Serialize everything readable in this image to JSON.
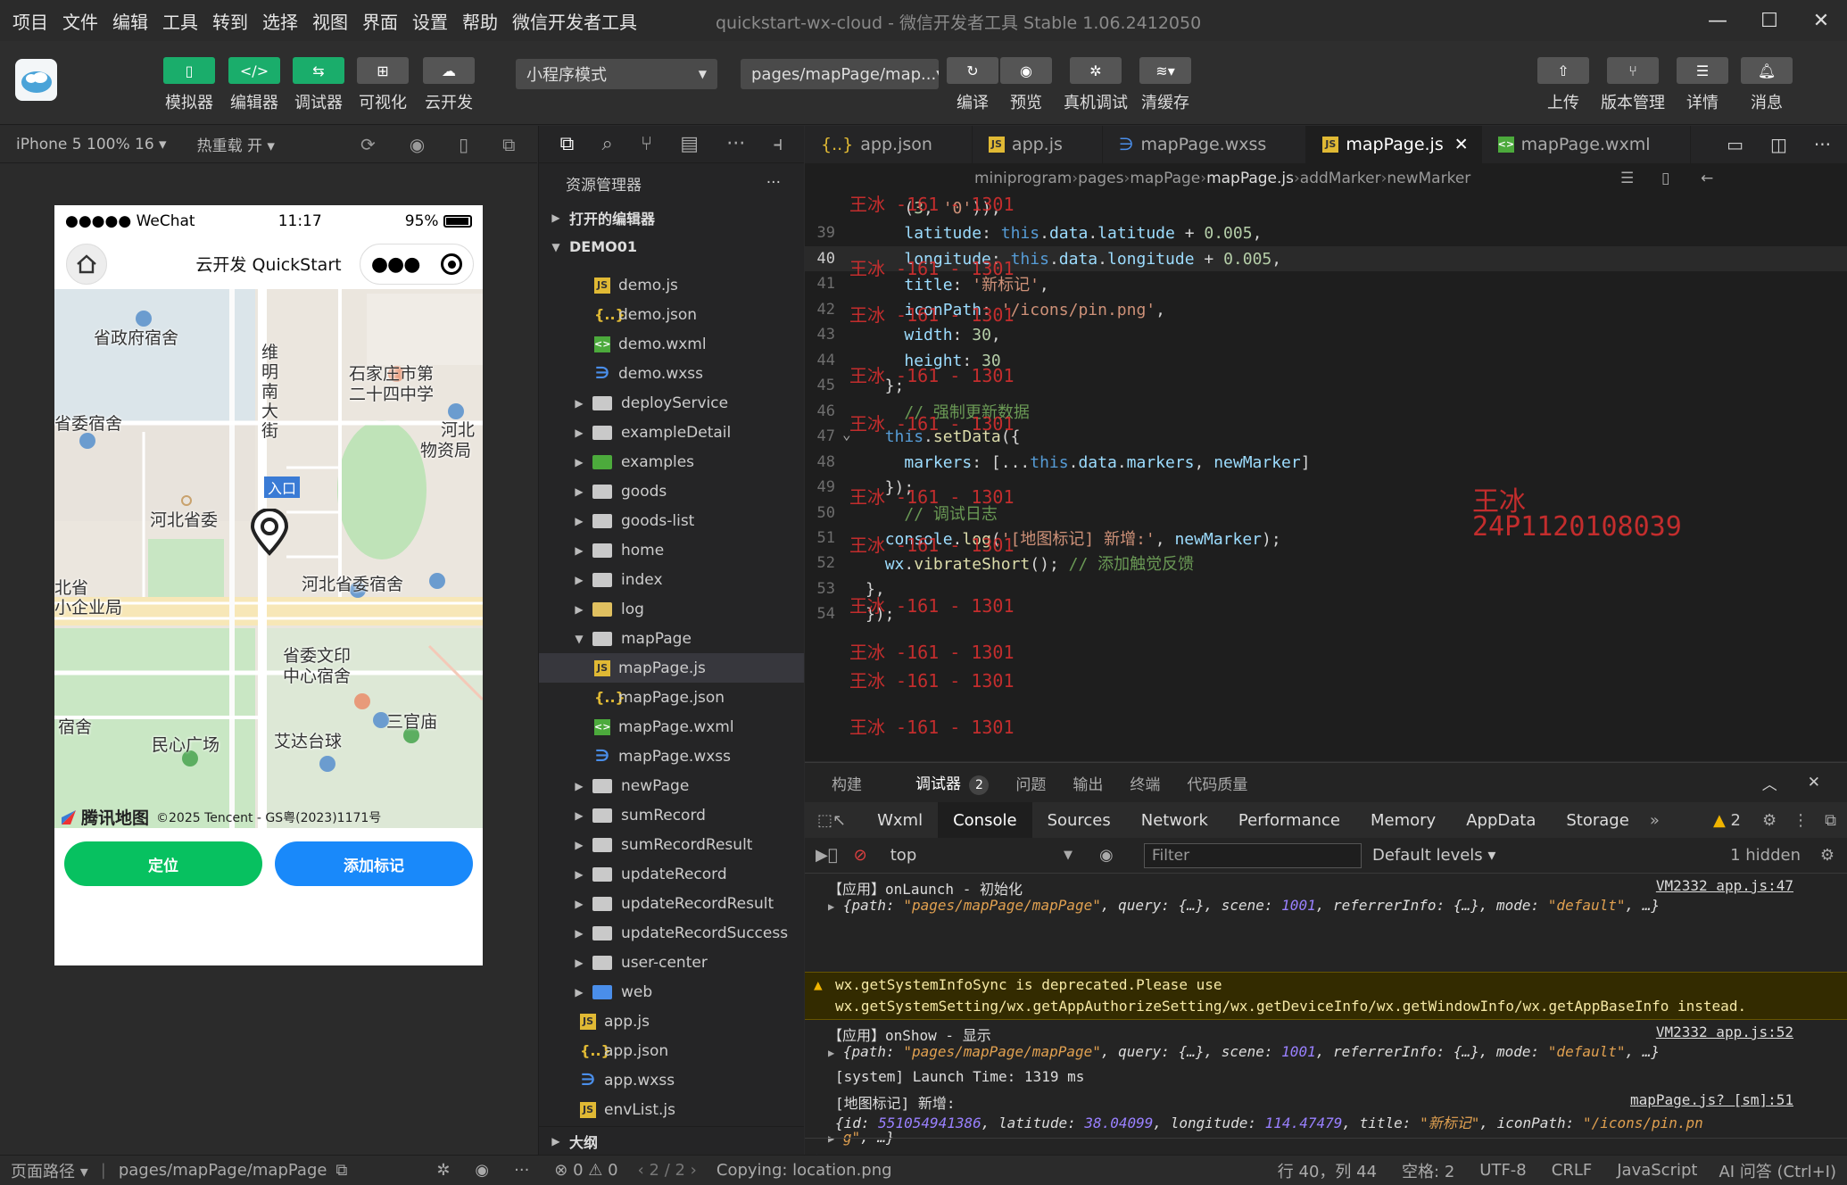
{
  "menu": [
    "项目",
    "文件",
    "编辑",
    "工具",
    "转到",
    "选择",
    "视图",
    "界面",
    "设置",
    "帮助",
    "微信开发者工具"
  ],
  "window_title": "quickstart-wx-cloud - 微信开发者工具 Stable 1.06.2412050",
  "toolbar": {
    "simulator": "模拟器",
    "editor": "编辑器",
    "debugger": "调试器",
    "visual": "可视化",
    "cloud": "云开发",
    "mode_select": "小程序模式",
    "page_select": "pages/mapPage/map...",
    "compile": "编译",
    "preview": "预览",
    "device_debug": "真机调试",
    "clear_cache": "清缓存",
    "upload": "上传",
    "version": "版本管理",
    "details": "详情",
    "messages": "消息"
  },
  "simbar": {
    "device": "iPhone 5 100% 16",
    "hot_reload": "热重载 开"
  },
  "phone": {
    "carrier": "●●●●● WeChat",
    "time": "11:17",
    "battery": "95%",
    "title": "云开发 QuickStart",
    "map_labels": {
      "l1": "省政府宿舍",
      "l2": "石家庄市第",
      "l3": "二十四中学",
      "l4": "省委宿舍",
      "l5": "河北",
      "l6": "物资局",
      "l7": "河北省委",
      "l8": "河北省委宿舍",
      "l9": "北省",
      "l10": "小企业局",
      "l11": "省委文印",
      "l12": "中心宿舍",
      "l13": "三官庙",
      "l14": "宿舍",
      "l15": "民心广场",
      "l16": "艾达台球",
      "l17": "入口",
      "road1": "维明南大街"
    },
    "map_brand": "腾讯地图",
    "map_copyright": "©2025 Tencent - GS粤(2023)1171号",
    "btn_locate": "定位",
    "btn_add_marker": "添加标记"
  },
  "explorer": {
    "title": "资源管理器",
    "open_editors": "打开的编辑器",
    "project": "DEMO01",
    "outline": "大纲",
    "items": [
      {
        "name": "demo.js",
        "type": "js",
        "indent": 2
      },
      {
        "name": "demo.json",
        "type": "json",
        "indent": 2
      },
      {
        "name": "demo.wxml",
        "type": "wxml",
        "indent": 2
      },
      {
        "name": "demo.wxss",
        "type": "wxss",
        "indent": 2
      },
      {
        "name": "deployService",
        "type": "folder",
        "indent": 1
      },
      {
        "name": "exampleDetail",
        "type": "folder",
        "indent": 1
      },
      {
        "name": "examples",
        "type": "folder-special",
        "indent": 1
      },
      {
        "name": "goods",
        "type": "folder",
        "indent": 1
      },
      {
        "name": "goods-list",
        "type": "folder",
        "indent": 1
      },
      {
        "name": "home",
        "type": "folder",
        "indent": 1
      },
      {
        "name": "index",
        "type": "folder",
        "indent": 1
      },
      {
        "name": "log",
        "type": "folder-log",
        "indent": 1
      },
      {
        "name": "mapPage",
        "type": "folder-open",
        "indent": 1
      },
      {
        "name": "mapPage.js",
        "type": "js",
        "indent": 2,
        "selected": true
      },
      {
        "name": "mapPage.json",
        "type": "json",
        "indent": 2
      },
      {
        "name": "mapPage.wxml",
        "type": "wxml",
        "indent": 2
      },
      {
        "name": "mapPage.wxss",
        "type": "wxss",
        "indent": 2
      },
      {
        "name": "newPage",
        "type": "folder",
        "indent": 1
      },
      {
        "name": "sumRecord",
        "type": "folder",
        "indent": 1
      },
      {
        "name": "sumRecordResult",
        "type": "folder",
        "indent": 1
      },
      {
        "name": "updateRecord",
        "type": "folder",
        "indent": 1
      },
      {
        "name": "updateRecordResult",
        "type": "folder",
        "indent": 1
      },
      {
        "name": "updateRecordSuccess",
        "type": "folder",
        "indent": 1
      },
      {
        "name": "user-center",
        "type": "folder",
        "indent": 1
      },
      {
        "name": "web",
        "type": "folder-web",
        "indent": 1
      },
      {
        "name": "app.js",
        "type": "js",
        "indent": 0
      },
      {
        "name": "app.json",
        "type": "json",
        "indent": 0
      },
      {
        "name": "app.wxss",
        "type": "wxss",
        "indent": 0
      },
      {
        "name": "envList.js",
        "type": "js",
        "indent": 0
      }
    ]
  },
  "editor": {
    "tabs": [
      {
        "name": "app.json",
        "icon": "{..}"
      },
      {
        "name": "app.js",
        "icon": "JS"
      },
      {
        "name": "mapPage.wxss",
        "icon": "wxss"
      },
      {
        "name": "mapPage.js",
        "icon": "JS",
        "active": true
      },
      {
        "name": "mapPage.wxml",
        "icon": "wxml"
      }
    ],
    "breadcrumb": [
      "miniprogram",
      "pages",
      "mapPage",
      "mapPage.js",
      "addMarker",
      "newMarker"
    ],
    "lines": [
      {
        "num": "",
        "html": "    (<span class='n'>3</span>, <span class='s'>'0'</span>)),"
      },
      {
        "num": "39",
        "html": "    <span class='p'>latitude</span>: <span class='k'>this</span>.<span class='p'>data</span>.<span class='p'>latitude</span> + <span class='n'>0.005</span>,"
      },
      {
        "num": "40",
        "html": "    <span class='p'>longitude</span>: <span class='k'>this</span>.<span class='p'>data</span>.<span class='p'>longitude</span> + <span class='n'>0.005</span>,",
        "current": true
      },
      {
        "num": "41",
        "html": "    <span class='p'>title</span>: <span class='s'>'新标记'</span>,"
      },
      {
        "num": "42",
        "html": "    <span class='p'>iconPath</span>: <span class='s'>'/icons/pin.png'</span>,"
      },
      {
        "num": "43",
        "html": "    <span class='p'>width</span>: <span class='n'>30</span>,"
      },
      {
        "num": "44",
        "html": "    <span class='p'>height</span>: <span class='n'>30</span>"
      },
      {
        "num": "45",
        "html": "  };"
      },
      {
        "num": "46",
        "html": "    <span class='c'>// 强制更新数据</span>"
      },
      {
        "num": "47",
        "html": "  <span class='k'>this</span>.<span class='f'>setData</span>({"
      },
      {
        "num": "48",
        "html": "    <span class='p'>markers</span>: [...<span class='k'>this</span>.<span class='p'>data</span>.<span class='p'>markers</span>, <span class='p'>newMarker</span>]"
      },
      {
        "num": "49",
        "html": "  });"
      },
      {
        "num": "50",
        "html": "    <span class='c'>// 调试日志</span>"
      },
      {
        "num": "51",
        "html": "  <span class='p'>console</span>.<span class='f'>log</span>(<span class='s'>'[地图标记] 新增:'</span>, <span class='p'>newMarker</span>);"
      },
      {
        "num": "52",
        "html": "  <span class='p'>wx</span>.<span class='f'>vibrateShort</span>(); <span class='c'>// 添加触觉反馈</span>"
      },
      {
        "num": "53",
        "html": "},"
      },
      {
        "num": "54",
        "html": "});"
      }
    ],
    "watermark_name": "王冰",
    "watermark_id": "24P1120108039",
    "watermark_small": "王冰 -161 - 1301"
  },
  "devtools": {
    "top_tabs": [
      "构建",
      "调试器",
      "问题",
      "输出",
      "终端",
      "代码质量"
    ],
    "debugger_badge": "2",
    "panel_tabs": [
      "Wxml",
      "Console",
      "Sources",
      "Network",
      "Performance",
      "Memory",
      "AppData",
      "Storage"
    ],
    "warn_count": "2",
    "context": "top",
    "filter_placeholder": "Filter",
    "levels": "Default levels",
    "hidden": "1 hidden"
  },
  "console": {
    "l1": "【应用】onLaunch - 初始化",
    "l1src": "VM2332 app.js:47",
    "l2": "{path: <s>\"pages/mapPage/mapPage\"</s>, query: {…}, scene: <n>1001</n>, referrerInfo: {…}, mode: <s>\"default\"</s>, …}",
    "warn1": "wx.getSystemInfoSync is deprecated.Please use",
    "warn2": "wx.getSystemSetting/wx.getAppAuthorizeSetting/wx.getDeviceInfo/wx.getWindowInfo/wx.getAppBaseInfo instead.",
    "l3": "【应用】onShow - 显示",
    "l3src": "VM2332 app.js:52",
    "l4": "{path: <s>\"pages/mapPage/mapPage\"</s>, query: {…}, scene: <n>1001</n>, referrerInfo: {…}, mode: <s>\"default\"</s>, …}",
    "l5": "[system] Launch Time: 1319 ms",
    "l6": "[地图标记] 新增:",
    "l6src": "mapPage.js? [sm]:51",
    "l7": "{id: <n>551054941386</n>, latitude: <n>38.04099</n>, longitude: <n>114.47479</n>, title: <s>\"新标记\"</s>, iconPath: <s>\"/icons/pin.pn</s>",
    "l8": "<s>g\"</s>, …}"
  },
  "statusbar": {
    "page_path_label": "页面路径",
    "page_path": "pages/mapPage/mapPage",
    "errors": "0",
    "warnings": "0",
    "pager": "2 / 2",
    "message": "Copying: location.png",
    "cursor": "行 40，列 44",
    "indent": "空格: 2",
    "encoding": "UTF-8",
    "eol": "CRLF",
    "language": "JavaScript",
    "ai": "AI 问答 (Ctrl+I)"
  }
}
